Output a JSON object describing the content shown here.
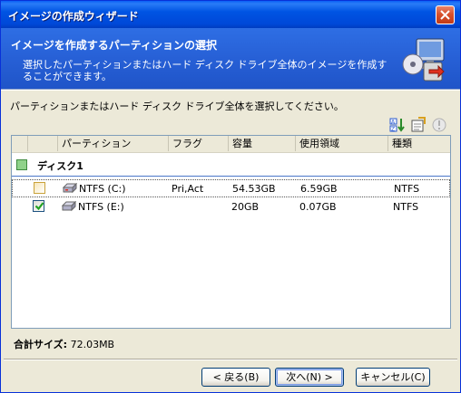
{
  "window": {
    "title": "イメージの作成ウィザード"
  },
  "header": {
    "title": "イメージを作成するパーティションの選択",
    "description": "選択したパーティションまたはハード ディスク ドライブ全体のイメージを作成することができます。"
  },
  "instruction": "パーティションまたはハード ディスク ドライブ全体を選択してください。",
  "toolbar_icons": [
    "sort-icon",
    "properties-icon",
    "info-icon"
  ],
  "columns": [
    "パーティション",
    "フラグ",
    "容量",
    "使用領域",
    "種類"
  ],
  "disk_group": {
    "label": "ディスク1",
    "checked": "partial"
  },
  "partitions": [
    {
      "name": "NTFS (C:)",
      "flag": "Pri,Act",
      "capacity": "54.53GB",
      "used": "6.59GB",
      "type": "NTFS",
      "checked": false
    },
    {
      "name": "NTFS (E:)",
      "flag": "",
      "capacity": "20GB",
      "used": "0.07GB",
      "type": "NTFS",
      "checked": true
    }
  ],
  "summary": {
    "label": "合計サイズ:",
    "value": "72.03MB"
  },
  "buttons": {
    "back": "< 戻る(B)",
    "next": "次へ(N) >",
    "cancel": "キャンセル(C)"
  },
  "colors": {
    "title_bar": "#0054e3",
    "header": "#2760d6",
    "window_bg": "#ece9d8",
    "check_green": "#3e8a3e"
  }
}
